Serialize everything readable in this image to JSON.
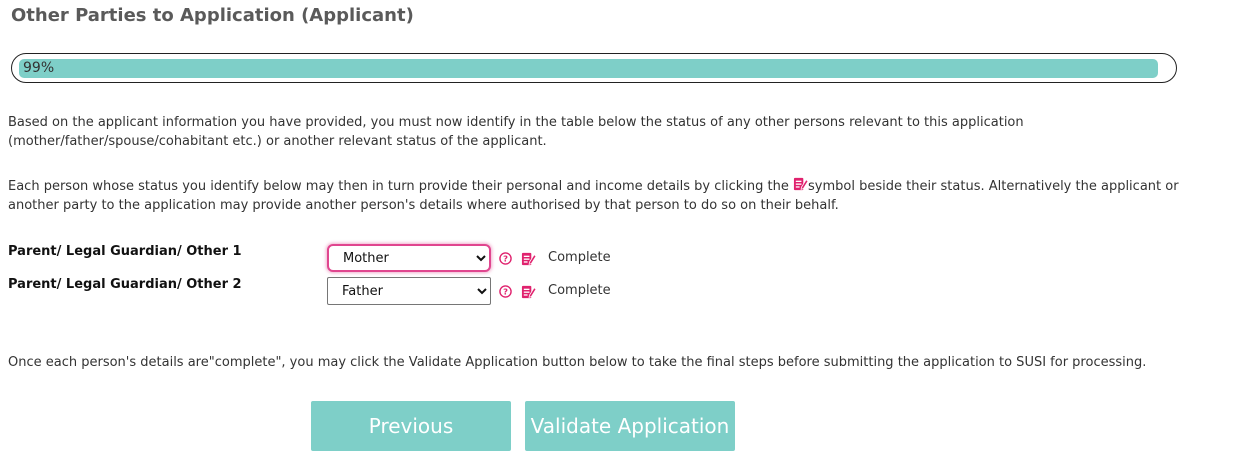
{
  "page": {
    "title": "Other Parties to Application (Applicant)"
  },
  "progress": {
    "value_percent": 99,
    "label": "99%",
    "fill_color": "#7ecfc8"
  },
  "intro": {
    "paragraph1": "Based on the applicant information you have provided, you must now identify in the table below the status of any other persons relevant to this application (mother/father/spouse/cohabitant etc.) or another relevant status of the applicant.",
    "paragraph2_before_icon": "Each person whose status you identify below may then in turn provide their personal and income details by clicking the ",
    "paragraph2_after_icon": "symbol beside their status. Alternatively the applicant or another party to the application may provide another person's details where authorised by that person to do so on their behalf."
  },
  "parties": [
    {
      "label": "Parent/ Legal Guardian/ Other 1",
      "selected": "Mother",
      "status": "Complete"
    },
    {
      "label": "Parent/ Legal Guardian/ Other 2",
      "selected": "Father",
      "status": "Complete"
    }
  ],
  "footer": {
    "note": "Once each person's details are\"complete\", you may click the Validate Application button below to take the final steps before submitting the application to SUSI for processing."
  },
  "buttons": {
    "previous": "Previous",
    "validate": "Validate Application"
  },
  "colors": {
    "accent": "#7ecfc8",
    "icon_pink": "#e0226e",
    "focus_border": "#e0468f"
  },
  "icons": {
    "help": "question-circle-icon",
    "edit": "edit-document-icon"
  }
}
